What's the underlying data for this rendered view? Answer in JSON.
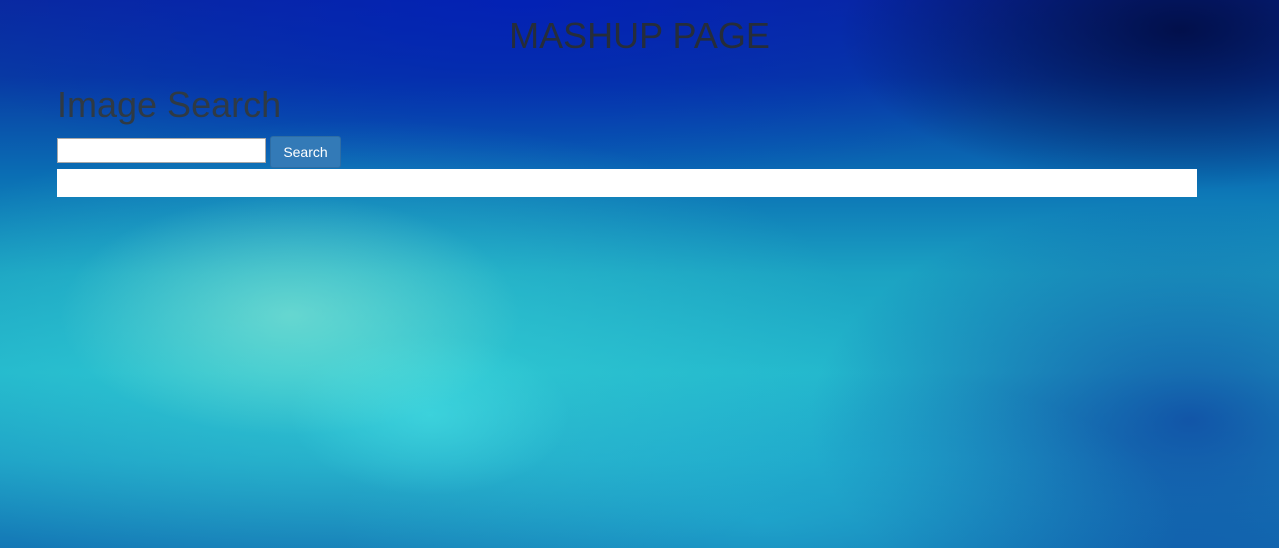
{
  "header": {
    "title": "MASHUP PAGE"
  },
  "image_search": {
    "heading": "Image Search",
    "input_value": "",
    "button_label": "Search"
  },
  "colors": {
    "button_bg": "#337ab7",
    "results_bg": "#ffffff",
    "heading_text": "#333333"
  }
}
